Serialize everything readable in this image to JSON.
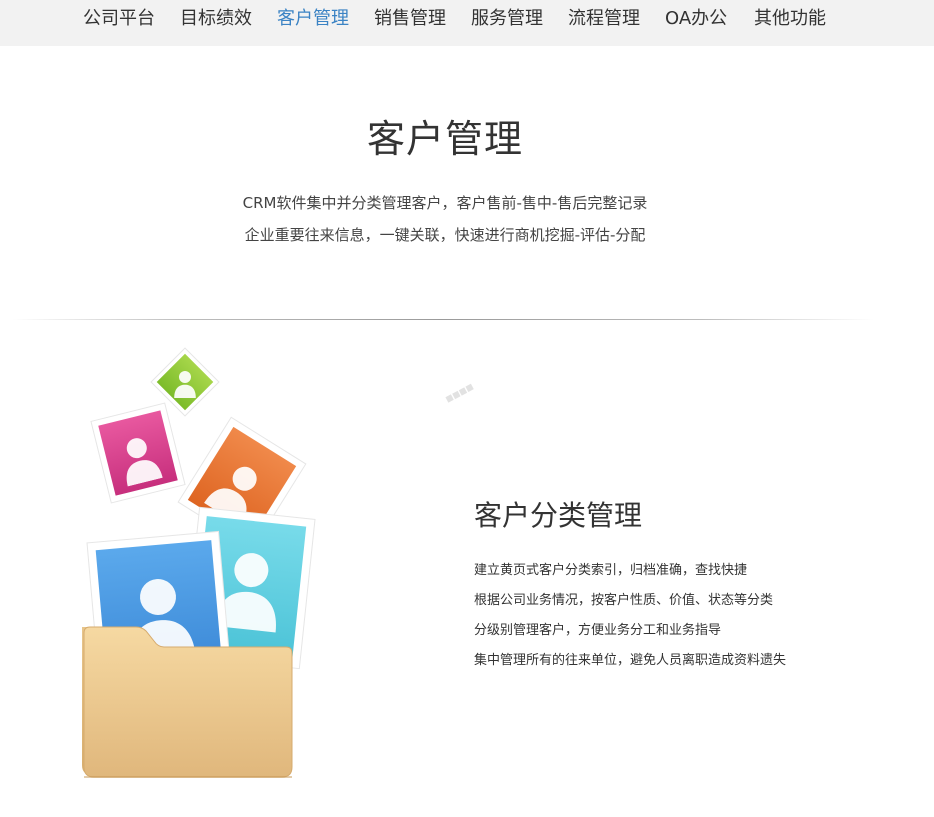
{
  "nav": {
    "items": [
      {
        "label": "公司平台"
      },
      {
        "label": "目标绩效"
      },
      {
        "label": "客户管理",
        "active": true
      },
      {
        "label": "销售管理"
      },
      {
        "label": "服务管理"
      },
      {
        "label": "流程管理"
      },
      {
        "label": "OA办公"
      },
      {
        "label": "其他功能"
      }
    ],
    "active_color": "#3b83c4",
    "background": "#f2f2f2"
  },
  "hero": {
    "title": "客户管理",
    "subtitle_lines": [
      "CRM软件集中并分类管理客户，客户售前-售中-售后完整记录",
      "企业重要往来信息，一键关联，快速进行商机挖掘-评估-分配"
    ]
  },
  "feature": {
    "title": "客户分类管理",
    "lines": [
      "建立黄页式客户分类索引，归档准确，查找快捷",
      "根据公司业务情况，按客户性质、价值、状态等分类",
      "分级别管理客户，方便业务分工和业务指导",
      "集中管理所有的往来单位，避免人员离职造成资料遗失"
    ],
    "illustration_icon": "contact-folder-icon"
  },
  "watermark": "■■■■"
}
